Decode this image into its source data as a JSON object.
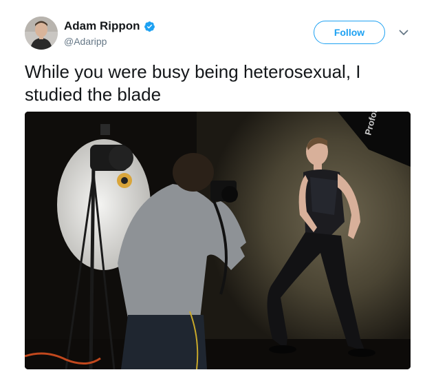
{
  "tweet": {
    "author": {
      "display_name": "Adam Rippon",
      "handle": "@Adaripp",
      "verified": true,
      "avatar_icon": "profile-avatar"
    },
    "follow_label": "Follow",
    "text": "While you were busy being heterosexual, I studied the blade",
    "media": {
      "description_icon": "photo-studio-image",
      "backdrop_label": "Profoto"
    }
  },
  "colors": {
    "accent": "#1da1f2",
    "text_primary": "#14171a",
    "text_secondary": "#657786"
  }
}
